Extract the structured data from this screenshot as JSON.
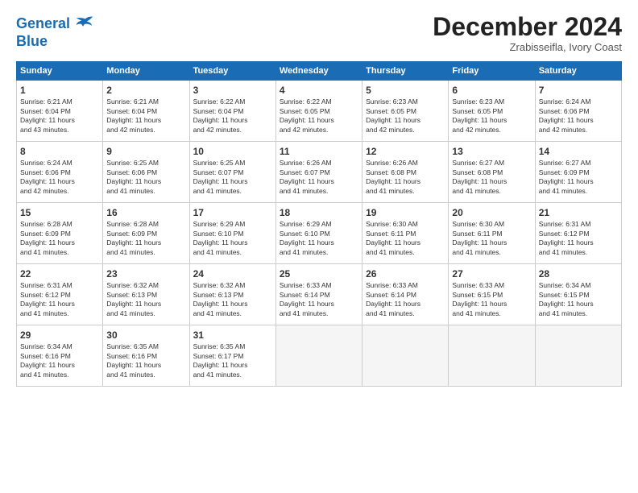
{
  "header": {
    "logo_line1": "General",
    "logo_line2": "Blue",
    "month": "December 2024",
    "location": "Zrabisseifla, Ivory Coast"
  },
  "weekdays": [
    "Sunday",
    "Monday",
    "Tuesday",
    "Wednesday",
    "Thursday",
    "Friday",
    "Saturday"
  ],
  "weeks": [
    [
      {
        "day": "1",
        "info": "Sunrise: 6:21 AM\nSunset: 6:04 PM\nDaylight: 11 hours\nand 43 minutes."
      },
      {
        "day": "2",
        "info": "Sunrise: 6:21 AM\nSunset: 6:04 PM\nDaylight: 11 hours\nand 42 minutes."
      },
      {
        "day": "3",
        "info": "Sunrise: 6:22 AM\nSunset: 6:04 PM\nDaylight: 11 hours\nand 42 minutes."
      },
      {
        "day": "4",
        "info": "Sunrise: 6:22 AM\nSunset: 6:05 PM\nDaylight: 11 hours\nand 42 minutes."
      },
      {
        "day": "5",
        "info": "Sunrise: 6:23 AM\nSunset: 6:05 PM\nDaylight: 11 hours\nand 42 minutes."
      },
      {
        "day": "6",
        "info": "Sunrise: 6:23 AM\nSunset: 6:05 PM\nDaylight: 11 hours\nand 42 minutes."
      },
      {
        "day": "7",
        "info": "Sunrise: 6:24 AM\nSunset: 6:06 PM\nDaylight: 11 hours\nand 42 minutes."
      }
    ],
    [
      {
        "day": "8",
        "info": "Sunrise: 6:24 AM\nSunset: 6:06 PM\nDaylight: 11 hours\nand 42 minutes."
      },
      {
        "day": "9",
        "info": "Sunrise: 6:25 AM\nSunset: 6:06 PM\nDaylight: 11 hours\nand 41 minutes."
      },
      {
        "day": "10",
        "info": "Sunrise: 6:25 AM\nSunset: 6:07 PM\nDaylight: 11 hours\nand 41 minutes."
      },
      {
        "day": "11",
        "info": "Sunrise: 6:26 AM\nSunset: 6:07 PM\nDaylight: 11 hours\nand 41 minutes."
      },
      {
        "day": "12",
        "info": "Sunrise: 6:26 AM\nSunset: 6:08 PM\nDaylight: 11 hours\nand 41 minutes."
      },
      {
        "day": "13",
        "info": "Sunrise: 6:27 AM\nSunset: 6:08 PM\nDaylight: 11 hours\nand 41 minutes."
      },
      {
        "day": "14",
        "info": "Sunrise: 6:27 AM\nSunset: 6:09 PM\nDaylight: 11 hours\nand 41 minutes."
      }
    ],
    [
      {
        "day": "15",
        "info": "Sunrise: 6:28 AM\nSunset: 6:09 PM\nDaylight: 11 hours\nand 41 minutes."
      },
      {
        "day": "16",
        "info": "Sunrise: 6:28 AM\nSunset: 6:09 PM\nDaylight: 11 hours\nand 41 minutes."
      },
      {
        "day": "17",
        "info": "Sunrise: 6:29 AM\nSunset: 6:10 PM\nDaylight: 11 hours\nand 41 minutes."
      },
      {
        "day": "18",
        "info": "Sunrise: 6:29 AM\nSunset: 6:10 PM\nDaylight: 11 hours\nand 41 minutes."
      },
      {
        "day": "19",
        "info": "Sunrise: 6:30 AM\nSunset: 6:11 PM\nDaylight: 11 hours\nand 41 minutes."
      },
      {
        "day": "20",
        "info": "Sunrise: 6:30 AM\nSunset: 6:11 PM\nDaylight: 11 hours\nand 41 minutes."
      },
      {
        "day": "21",
        "info": "Sunrise: 6:31 AM\nSunset: 6:12 PM\nDaylight: 11 hours\nand 41 minutes."
      }
    ],
    [
      {
        "day": "22",
        "info": "Sunrise: 6:31 AM\nSunset: 6:12 PM\nDaylight: 11 hours\nand 41 minutes."
      },
      {
        "day": "23",
        "info": "Sunrise: 6:32 AM\nSunset: 6:13 PM\nDaylight: 11 hours\nand 41 minutes."
      },
      {
        "day": "24",
        "info": "Sunrise: 6:32 AM\nSunset: 6:13 PM\nDaylight: 11 hours\nand 41 minutes."
      },
      {
        "day": "25",
        "info": "Sunrise: 6:33 AM\nSunset: 6:14 PM\nDaylight: 11 hours\nand 41 minutes."
      },
      {
        "day": "26",
        "info": "Sunrise: 6:33 AM\nSunset: 6:14 PM\nDaylight: 11 hours\nand 41 minutes."
      },
      {
        "day": "27",
        "info": "Sunrise: 6:33 AM\nSunset: 6:15 PM\nDaylight: 11 hours\nand 41 minutes."
      },
      {
        "day": "28",
        "info": "Sunrise: 6:34 AM\nSunset: 6:15 PM\nDaylight: 11 hours\nand 41 minutes."
      }
    ],
    [
      {
        "day": "29",
        "info": "Sunrise: 6:34 AM\nSunset: 6:16 PM\nDaylight: 11 hours\nand 41 minutes."
      },
      {
        "day": "30",
        "info": "Sunrise: 6:35 AM\nSunset: 6:16 PM\nDaylight: 11 hours\nand 41 minutes."
      },
      {
        "day": "31",
        "info": "Sunrise: 6:35 AM\nSunset: 6:17 PM\nDaylight: 11 hours\nand 41 minutes."
      },
      null,
      null,
      null,
      null
    ]
  ]
}
